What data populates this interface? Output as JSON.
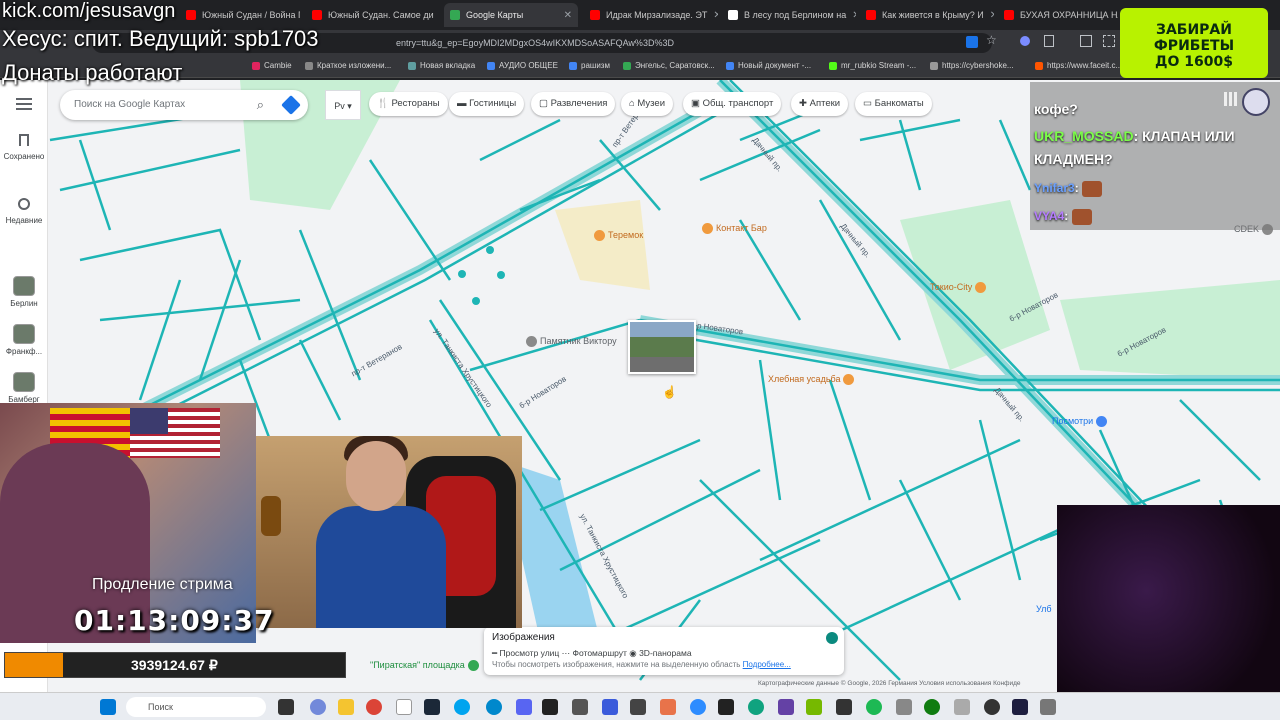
{
  "browser": {
    "tabs": [
      {
        "label": "Южный Судан / Война Г",
        "color": "#ff0000"
      },
      {
        "label": "Южный Судан. Самое ди",
        "color": "#ff0000"
      },
      {
        "label": "Google Карты",
        "color": "#34a853"
      },
      {
        "label": "Идрак Мирзализаде. ЭТ",
        "color": "#ff0000"
      },
      {
        "label": "В лесу под Берлином на",
        "color": "#ffffff"
      },
      {
        "label": "Как живется в Крыму? И",
        "color": "#ff0000"
      },
      {
        "label": "БУХАЯ ОХРАННИЦА НА",
        "color": "#ff0000"
      }
    ],
    "url": "entry=ttu&g_ep=EgoyMDI2MDgxOS4wIKXMDSoASAFQAw%3D%3D",
    "bookmarks": [
      "Cambie",
      "Краткое изложени...",
      "Новая вкладка",
      "АУДИО ОБЩЕЕ",
      "рашизм",
      "Энгельс, Саратовск...",
      "Новый документ -...",
      "mr_rubkio Stream -...",
      "https://cybershoke...",
      "https://www.faceit.c..."
    ]
  },
  "maps": {
    "search_placeholder": "Поиск на Google Картах",
    "layer_label": "Рv",
    "chips": [
      "Рестораны",
      "Гостиницы",
      "Развлечения",
      "Музеи",
      "Общ. транспорт",
      "Аптеки",
      "Банкоматы"
    ],
    "sidebar": {
      "saved": "Сохранено",
      "recent": "Недавние",
      "places": [
        "Берлин",
        "Франкф...",
        "Бамберг"
      ]
    },
    "pois": {
      "teremok": "Теремок",
      "kontakt": "Контакт Бар",
      "tokio": "Токио-City",
      "pamyatnik": "Памятник Виктору",
      "usadba": "Хлебная усадьба",
      "posmotri": "Посмотри",
      "cdek": "CDEK",
      "pirat": "\"Пиратская\" площадка",
      "ulb": "Улб"
    },
    "roads": {
      "veteranov1": "пр-т Ветеранов",
      "veteranov2": "пр-т Ветеранов",
      "tankista1": "ул. Танкиста Хрустицкого",
      "tankista2": "ул. Танкиста Хрустицкого",
      "novatorov1": "6-р Новаторов",
      "novatorov2": "6-р Новаторов",
      "novatorov3": "6-р Новаторов",
      "novatorov4": "6-р Новаторов",
      "dachny1": "Дачный пр.",
      "dachny2": "Дачный пр.",
      "dachny3": "Дачный пр."
    },
    "images_panel": {
      "title": "Изображения",
      "legend": "━ Просмотр улиц   ⋯ Фотомаршрут   ◉ 3D-панорама",
      "hint": "Чтобы посмотреть изображения, нажмите на выделенную область ",
      "more": "Подробнее..."
    },
    "footer": "Картографические данные © Google, 2026    Германия    Условия использования    Конфиде"
  },
  "chat": {
    "messages": [
      {
        "user": "",
        "text": "кофе?"
      },
      {
        "user": "UKR_MOSSAD",
        "text": ": КЛАПАН ИЛИ"
      },
      {
        "user": "",
        "text": "КЛАДМЕН?"
      },
      {
        "user": "Ynifar3",
        "text": ":"
      },
      {
        "user": "VYA4",
        "text": ":"
      }
    ]
  },
  "promo": {
    "line1": "ЗАБИРАЙ",
    "line2": "ФРИБЕТЫ",
    "line3": "ДО 1600$"
  },
  "stream": {
    "url": "kick.com/jesusavgn",
    "title": "Хесус: спит. Ведущий: spb1703",
    "donations": "Донаты работают",
    "timer_label": "Продление стрима",
    "timer": "01:13:09:37",
    "donation_total": "3939124.67 ₽",
    "donation_progress": 0.17
  },
  "taskbar": {
    "search": "Поиск"
  },
  "colors": {
    "road": "#1eb5b5",
    "park": "#c8efd4",
    "water": "#9ad4f0",
    "accent": "#1a73e8"
  }
}
